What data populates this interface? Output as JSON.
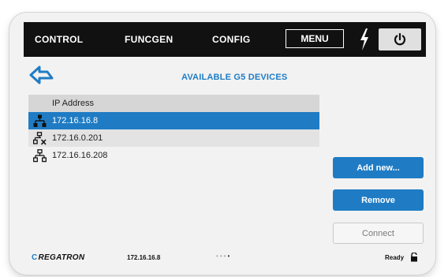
{
  "topbar": {
    "tabs": [
      {
        "label": "CONTROL"
      },
      {
        "label": "FUNCGEN"
      },
      {
        "label": "CONFIG"
      }
    ],
    "menu_label": "MENU",
    "icons": {
      "bolt": "lightning-icon",
      "power": "power-icon"
    }
  },
  "page": {
    "title": "AVAILABLE G5 DEVICES",
    "back_icon": "back-arrow-icon"
  },
  "table": {
    "header": "IP Address",
    "rows": [
      {
        "ip": "172.16.16.8",
        "icon": "network-connected-icon",
        "selected": true
      },
      {
        "ip": "172.16.0.201",
        "icon": "network-disconnected-icon",
        "selected": false
      },
      {
        "ip": "172.16.16.208",
        "icon": "network-icon",
        "selected": false
      }
    ]
  },
  "buttons": {
    "add_new": "Add new...",
    "remove": "Remove",
    "connect": "Connect"
  },
  "status": {
    "brand": "REGATRON",
    "ip": "172.16.16.8",
    "state": "Ready"
  },
  "colors": {
    "accent": "#1f7cc4",
    "topbar": "#111111",
    "background": "#f2f2f2"
  }
}
